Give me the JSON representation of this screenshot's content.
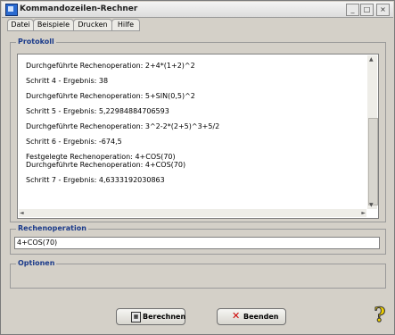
{
  "window": {
    "title": "Kommandozeilen-Rechner"
  },
  "menu": {
    "items": [
      "Datei",
      "Beispiele",
      "Drucken",
      "Hilfe"
    ]
  },
  "protokoll": {
    "legend": "Protokoll",
    "lines": [
      "Durchgeführte Rechenoperation: 2+4*(1+2)^2",
      "",
      "Schritt 4 - Ergebnis: 38",
      "",
      "Durchgeführte Rechenoperation: 5+SIN(0,5)^2",
      "",
      "Schritt 5 - Ergebnis: 5,22984884706593",
      "",
      "Durchgeführte Rechenoperation: 3^2-2*(2+5)^3+5/2",
      "",
      "Schritt 6 - Ergebnis: -674,5",
      "",
      "Festgelegte Rechenoperation: 4+COS(70)",
      "Durchgeführte Rechenoperation: 4+COS(70)",
      "",
      "Schritt 7 - Ergebnis: 4,6333192030863"
    ]
  },
  "rechenoperation": {
    "legend": "Rechenoperation",
    "value": "4+COS(70)"
  },
  "optionen": {
    "legend": "Optionen"
  },
  "buttons": {
    "berechnen": "Berechnen",
    "beenden": "Beenden"
  },
  "icons": {
    "help": "help-icon",
    "calculator": "calculator-icon",
    "close": "close-x-icon"
  },
  "colors": {
    "legend": "#1a3a8a",
    "beenden_x": "#cc0000",
    "help": "#f0d000"
  }
}
